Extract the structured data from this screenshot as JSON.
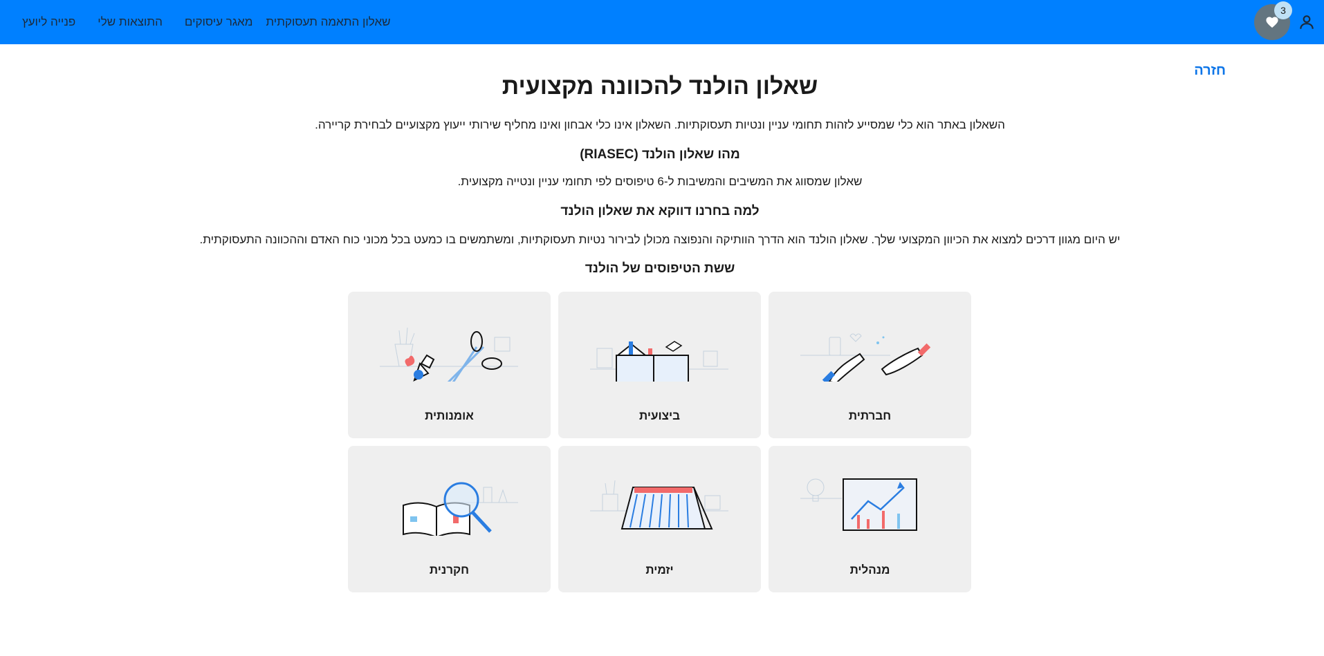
{
  "nav": {
    "links": [
      "שאלון התאמה תעסוקתית",
      "מאגר עיסוקים",
      "התוצאות שלי",
      "פנייה ליועץ"
    ],
    "favorites_count": "3",
    "user_icon": "person-icon",
    "favorites_icon": "heart-icon"
  },
  "back_label": "חזרה",
  "title": "שאלון הולנד להכוונה מקצועית",
  "intro": "השאלון באתר הוא כלי שמסייע לזהות תחומי עניין ונטיות תעסוקתיות. השאלון אינו כלי אבחון ואינו מחליף שירותי ייעוץ מקצועיים לבחירת קריירה.",
  "section1": {
    "heading": "מהו שאלון הולנד (RIASEC)",
    "text": "שאלון שמסווג את המשיבים והמשיבות ל-6 טיפוסים לפי תחומי עניין ונטייה מקצועית."
  },
  "section2": {
    "heading": "למה בחרנו דווקא את שאלון הולנד",
    "text": "יש היום מגוון דרכים למצוא את הכיוון המקצועי שלך. שאלון הולנד הוא הדרך הוותיקה והנפוצה מכולן לבירור נטיות תעסוקתיות, ומשתמשים בו כמעט בכל מכוני כוח האדם וההכוונה התעסוקתית."
  },
  "types_heading": "ששת הטיפוסים של הולנד",
  "types": [
    {
      "label": "חברתית",
      "icon": "hands-icon"
    },
    {
      "label": "ביצועית",
      "icon": "toolbox-icon"
    },
    {
      "label": "אומנותית",
      "icon": "scissors-icon"
    },
    {
      "label": "מנהלית",
      "icon": "growth-chart-icon"
    },
    {
      "label": "יזמית",
      "icon": "calendar-icon"
    },
    {
      "label": "חקרנית",
      "icon": "magnifier-book-icon"
    }
  ],
  "colors": {
    "header": "#0080ff",
    "accent_blue": "#2a7de1",
    "accent_red": "#f26a6a",
    "card_bg": "#efefef"
  }
}
